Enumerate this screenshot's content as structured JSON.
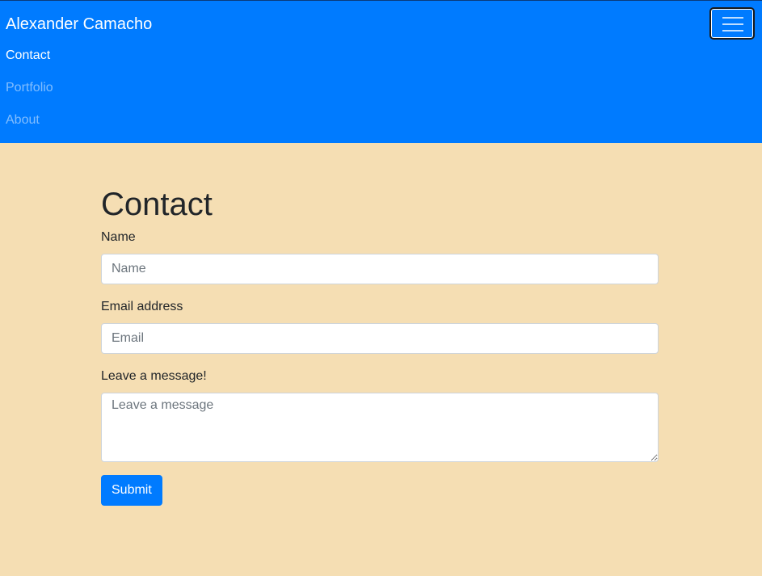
{
  "navbar": {
    "brand": "Alexander Camacho",
    "toggler_icon": "hamburger-menu-icon",
    "links": [
      {
        "label": "Contact",
        "active": true
      },
      {
        "label": "Portfolio",
        "active": false
      },
      {
        "label": "About",
        "active": false
      }
    ]
  },
  "main": {
    "title": "Contact",
    "form": {
      "name_label": "Name",
      "name_placeholder": "Name",
      "email_label": "Email address",
      "email_placeholder": "Email",
      "message_label": "Leave a message!",
      "message_placeholder": "Leave a message",
      "submit_label": "Submit"
    }
  },
  "colors": {
    "navbar_bg": "#007bff",
    "page_bg": "#f5deb3",
    "button_bg": "#007bff"
  }
}
